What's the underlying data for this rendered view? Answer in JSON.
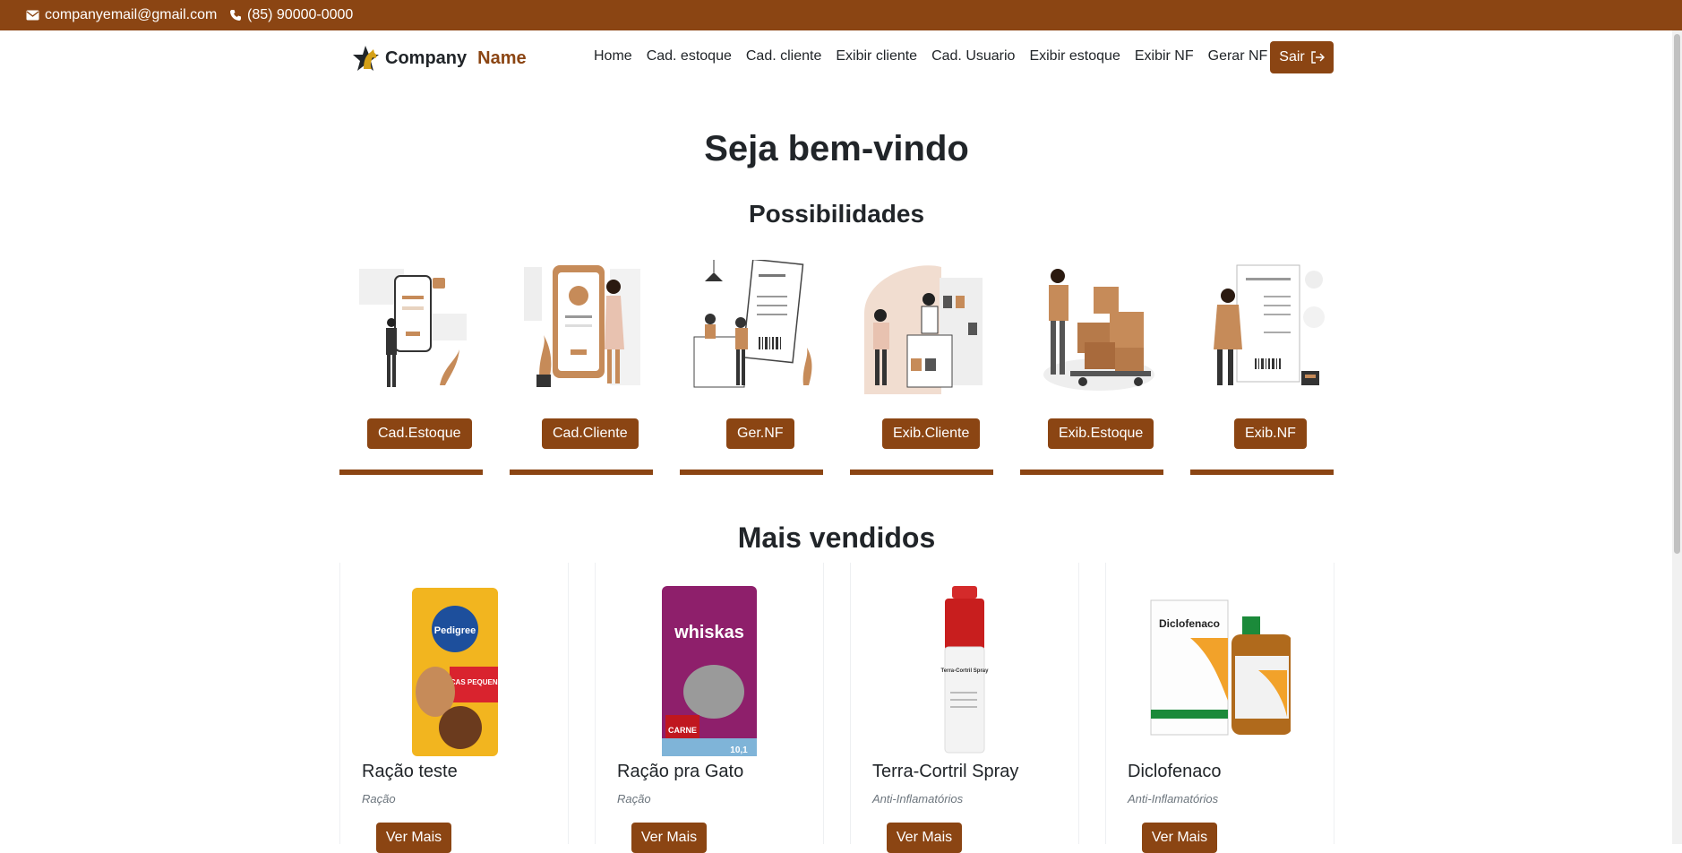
{
  "topbar": {
    "email": "companyemail@gmail.com",
    "phone": "(85) 90000-0000",
    "color": "#8b4513"
  },
  "brand": {
    "part1": "Company",
    "part2": "Name"
  },
  "nav": {
    "items": [
      "Home",
      "Cad. estoque",
      "Cad. cliente",
      "Exibir cliente",
      "Cad. Usuario",
      "Exibir estoque",
      "Exibir NF",
      "Gerar NF"
    ],
    "logout": "Sair"
  },
  "main": {
    "title": "Seja bem-vindo",
    "subtitle": "Possibilidades",
    "best_sellers": "Mais vendidos"
  },
  "features": [
    {
      "label": "Cad.Estoque",
      "icon": "mobile-form-illustration-icon"
    },
    {
      "label": "Cad.Cliente",
      "icon": "mobile-welcome-illustration-icon"
    },
    {
      "label": "Ger.NF",
      "icon": "store-receipt-illustration-icon"
    },
    {
      "label": "Exib.Cliente",
      "icon": "shop-counter-illustration-icon"
    },
    {
      "label": "Exib.Estoque",
      "icon": "warehouse-boxes-illustration-icon"
    },
    {
      "label": "Exib.NF",
      "icon": "receipt-reading-illustration-icon"
    }
  ],
  "products": [
    {
      "title": "Ração teste",
      "category": "Ração",
      "button": "Ver Mais",
      "image": "dog-food-bag-icon"
    },
    {
      "title": "Ração pra Gato",
      "category": "Ração",
      "button": "Ver Mais",
      "image": "cat-food-bag-icon"
    },
    {
      "title": "Terra-Cortril Spray",
      "category": "Anti-Inflamatórios",
      "button": "Ver Mais",
      "image": "spray-can-icon"
    },
    {
      "title": "Diclofenaco",
      "category": "Anti-Inflamatórios",
      "button": "Ver Mais",
      "image": "medicine-box-icon"
    }
  ],
  "product_image_text": {
    "pedigree_brand": "Pedigree",
    "pedigree_line": "RAÇAS PEQUENAS",
    "whiskas_brand": "whiskas",
    "whiskas_flavor": "CARNE",
    "whiskas_weight": "10,1",
    "spray_name": "Terra-Cortril Spray",
    "diclo_name": "Diclofenaco"
  }
}
